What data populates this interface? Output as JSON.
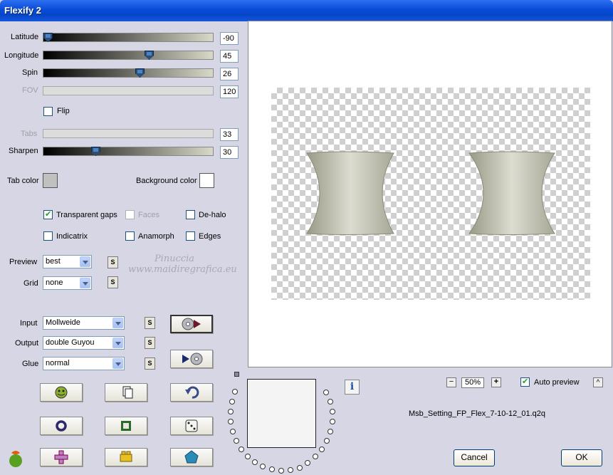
{
  "window": {
    "title": "Flexify 2"
  },
  "sliders": [
    {
      "label": "Latitude",
      "value": "-90",
      "fraction": 0.0,
      "enabled": true
    },
    {
      "label": "Longitude",
      "value": "45",
      "fraction": 0.62,
      "enabled": true
    },
    {
      "label": "Spin",
      "value": "26",
      "fraction": 0.57,
      "enabled": true
    },
    {
      "label": "FOV",
      "value": "120",
      "fraction": 0,
      "enabled": false
    }
  ],
  "flip_label": "Flip",
  "tabs": {
    "label": "Tabs",
    "value": "33"
  },
  "sharpen": {
    "label": "Sharpen",
    "value": "30",
    "fraction": 0.3
  },
  "tab_color": {
    "label": "Tab color",
    "color": "#c0c0c0"
  },
  "background_color": {
    "label": "Background color",
    "color": "#ffffff"
  },
  "options": {
    "transparent_gaps": "Transparent gaps",
    "faces": "Faces",
    "de_halo": "De-halo",
    "indicatrix": "Indicatrix",
    "anamorph": "Anamorph",
    "edges": "Edges"
  },
  "preview": {
    "label": "Preview",
    "value": "best"
  },
  "grid": {
    "label": "Grid",
    "value": "none"
  },
  "watermark": {
    "line1": "Pinuccia",
    "line2": "www.maidiregrafica.eu"
  },
  "input": {
    "label": "Input",
    "value": "Mollweide"
  },
  "output": {
    "label": "Output",
    "value": "double Guyou"
  },
  "glue": {
    "label": "Glue",
    "value": "normal"
  },
  "s_button": "S",
  "zoom": {
    "minus": "−",
    "value": "50%",
    "plus": "+"
  },
  "auto_preview": {
    "label": "Auto preview",
    "checked": true
  },
  "collapse_button": "^",
  "info_icon": "i",
  "preset_filename": "Msb_Setting_FP_Flex_7-10-12_01.q2q",
  "buttons": {
    "cancel": "Cancel",
    "ok": "OK"
  },
  "colors": {
    "title_bar": "#0a4cd8",
    "panel": "#d6d6e4",
    "shape": "#c6c6b8"
  }
}
